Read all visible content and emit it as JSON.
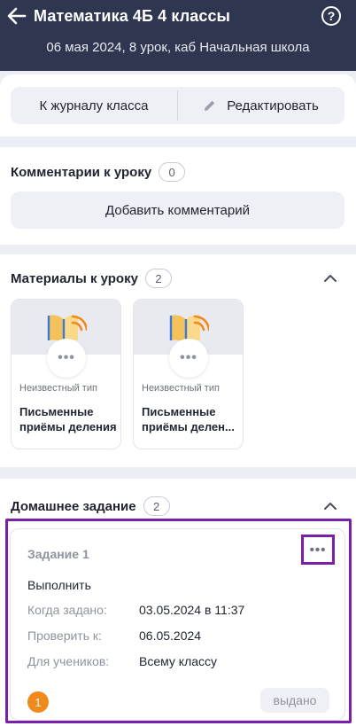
{
  "header": {
    "title": "Математика 4Б 4 классы",
    "subtitle": "06 мая 2024, 8 урок, каб Начальная школа",
    "help_glyph": "?"
  },
  "actions": {
    "journal_label": "К журналу класса",
    "edit_label": "Редактировать"
  },
  "comments": {
    "title": "Комментарии к уроку",
    "count": "0",
    "add_label": "Добавить комментарий"
  },
  "materials": {
    "title": "Материалы к уроку",
    "count": "2",
    "items": [
      {
        "type": "Неизвестный тип",
        "name": "Письменные приёмы деления"
      },
      {
        "type": "Неизвестный тип",
        "name": "Письменные приёмы делен..."
      }
    ]
  },
  "homework": {
    "title": "Домашнее задание",
    "count": "2",
    "task": {
      "title": "Задание 1",
      "action": "Выполнить",
      "assigned_label": "Когда задано:",
      "assigned_value": "03.05.2024 в 11:37",
      "check_label": "Проверить к:",
      "check_value": "06.05.2024",
      "students_label": "Для учеников:",
      "students_value": "Всему классу",
      "number": "1",
      "status": "выдано"
    }
  },
  "colors": {
    "header_bg": "#2f3650",
    "accent_orange": "#f08a1c",
    "highlight": "#7a1fa8"
  }
}
